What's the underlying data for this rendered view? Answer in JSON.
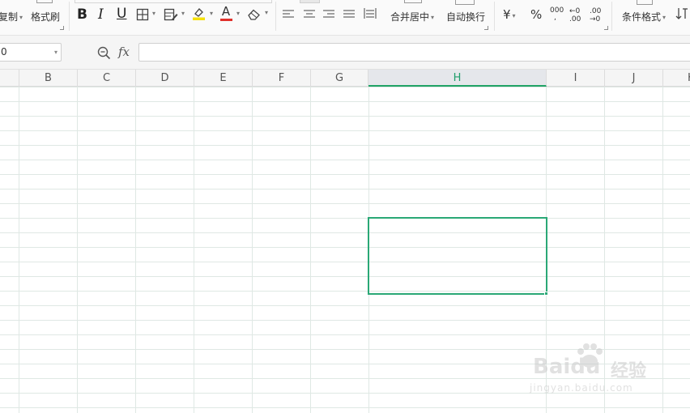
{
  "ribbon": {
    "copy_label": "复制",
    "format_painter_label": "格式刷",
    "bold_glyph": "B",
    "italic_glyph": "I",
    "underline_glyph": "U",
    "font_color_glyph": "A",
    "merge_center_label": "合并居中",
    "wrap_text_label": "自动换行",
    "currency_glyph": "¥",
    "percent_glyph": "%",
    "thousands_glyph": "000",
    "increase_decimal_glyph": "←0 .00",
    "decrease_decimal_glyph": ".00 →0",
    "conditional_format_label": "条件格式",
    "icons": [
      "bold-icon",
      "italic-icon",
      "underline-icon",
      "borders-icon",
      "fill-style-icon",
      "highlight-icon",
      "font-color-icon",
      "eraser-icon",
      "align-left-icon",
      "align-center-icon",
      "align-right-icon",
      "justify-icon",
      "distribute-icon",
      "merge-icon",
      "wrap-icon",
      "currency-icon",
      "percent-icon",
      "thousands-icon",
      "increase-decimal-icon",
      "decrease-decimal-icon",
      "conditional-format-icon",
      "sort-icon"
    ],
    "colors": {
      "highlight": "#f5e00b",
      "font_color": "#e0312b"
    }
  },
  "formula_bar": {
    "name_box_value": "0",
    "zoom_icon": "zoom-icon",
    "fx_label": "fx",
    "formula_value": ""
  },
  "grid": {
    "columns": [
      "B",
      "C",
      "D",
      "E",
      "F",
      "G",
      "H",
      "I",
      "J",
      "K"
    ],
    "selected_column": "H",
    "accent_color": "#2aa876"
  },
  "watermark": {
    "brand": "Baidu",
    "cn": "经验",
    "url": "jingyan.baidu.com"
  }
}
